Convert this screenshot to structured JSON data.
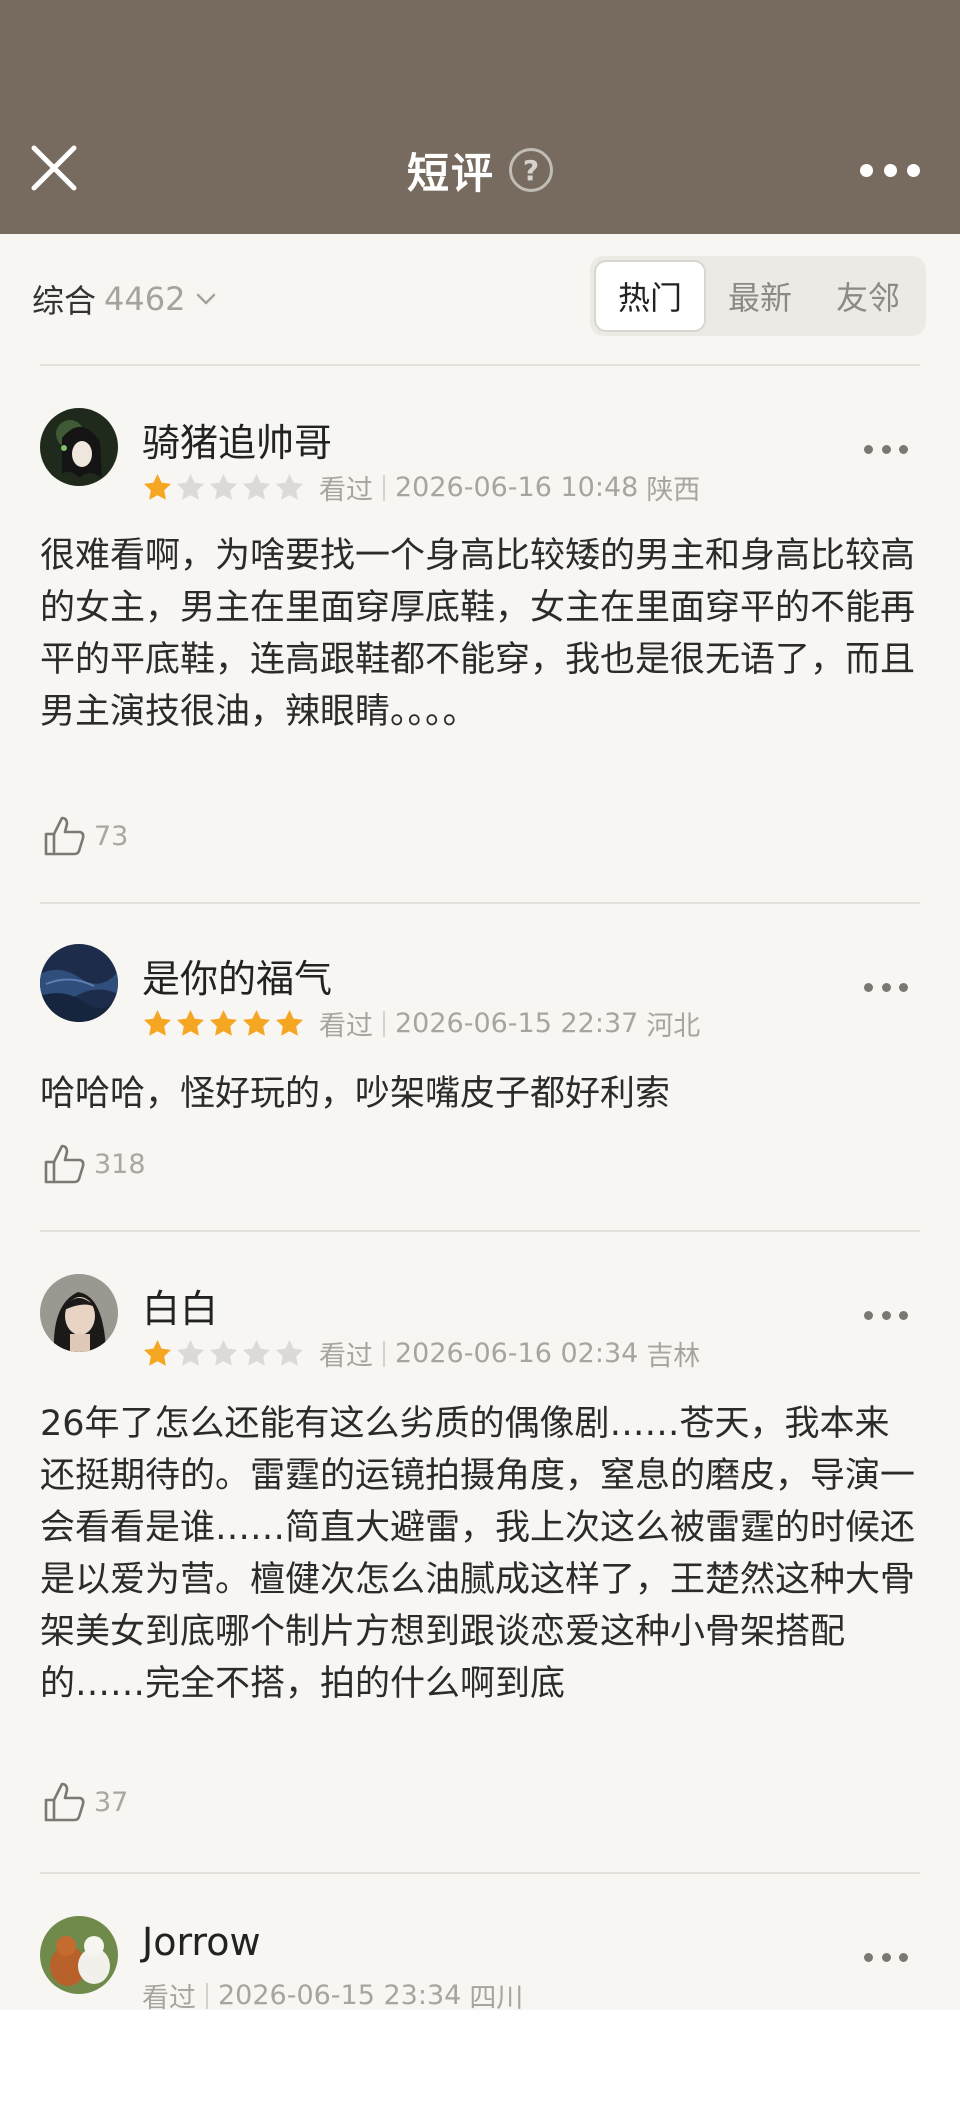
{
  "header": {
    "title": "短评",
    "help_icon": "question-circle-icon",
    "close_icon": "close-icon",
    "more_icon": "more-horizontal-icon"
  },
  "filter": {
    "sort_label": "综合",
    "count": "4462",
    "tabs": [
      "热门",
      "最新",
      "友邻"
    ],
    "active_tab": "热门"
  },
  "colors": {
    "header_bg": "#766b5e",
    "star_active": "#f5a623",
    "star_inactive": "#dcdad6"
  },
  "reviews": [
    {
      "username": "骑猪追帅哥",
      "rating": 1,
      "status": "看过",
      "datetime": "2026-06-16 10:48",
      "location": "陕西",
      "content": "很难看啊，为啥要找一个身高比较矮的男主和身高比较高的女主，男主在里面穿厚底鞋，女主在里面穿平的不能再平的平底鞋，连高跟鞋都不能穿，我也是很无语了，而且男主演技很油，辣眼睛。。。。",
      "likes": "73"
    },
    {
      "username": "是你的福气",
      "rating": 5,
      "status": "看过",
      "datetime": "2026-06-15 22:37",
      "location": "河北",
      "content": "哈哈哈，怪好玩的，吵架嘴皮子都好利索",
      "likes": "318"
    },
    {
      "username": "白白",
      "rating": 1,
      "status": "看过",
      "datetime": "2026-06-16 02:34",
      "location": "吉林",
      "content": "26年了怎么还能有这么劣质的偶像剧……苍天，我本来还挺期待的。雷霆的运镜拍摄角度，窒息的磨皮，导演一会看看是谁……简直大避雷，我上次这么被雷霆的时候还是以爱为营。檀健次怎么油腻成这样了，王楚然这种大骨架美女到底哪个制片方想到跟谈恋爱这种小骨架搭配的……完全不搭，拍的什么啊到底",
      "likes": "37"
    },
    {
      "username": "Jorrow",
      "rating": 0,
      "status": "看过",
      "datetime": "2026-06-15 23:34",
      "location": "四川",
      "content": "",
      "likes": ""
    }
  ]
}
